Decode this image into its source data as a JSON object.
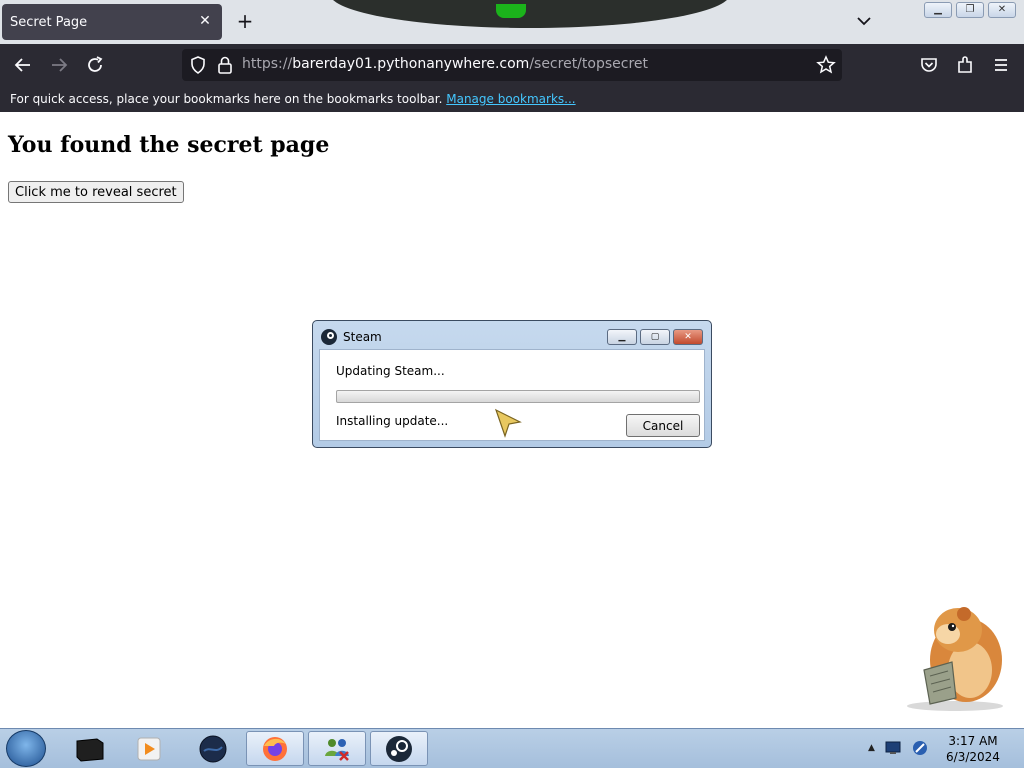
{
  "browser": {
    "tab": {
      "title": "Secret Page"
    },
    "address": {
      "prefix": "https://",
      "domain": "barerday01.pythonanywhere.com",
      "path": "/secret/topsecret"
    },
    "bookmarks_bar": {
      "message": "For quick access, place your bookmarks here on the bookmarks toolbar.",
      "link_label": "Manage bookmarks..."
    }
  },
  "page": {
    "heading": "You found the secret page",
    "button_label": "Click me to reveal secret"
  },
  "steam_dialog": {
    "title": "Steam",
    "status": "Updating Steam...",
    "progress_percent": 0,
    "detail": "Installing update...",
    "cancel_label": "Cancel"
  },
  "taskbar": {
    "items": [
      {
        "name": "start-orb-icon"
      },
      {
        "name": "dark-device-icon"
      },
      {
        "name": "media-player-icon"
      },
      {
        "name": "dark-globe-icon"
      },
      {
        "name": "firefox-icon"
      },
      {
        "name": "network-people-icon"
      },
      {
        "name": "steam-icon"
      }
    ],
    "clock": {
      "time": "3:17 AM",
      "date": "6/3/2024"
    }
  },
  "colors": {
    "browser_chrome": "#2b2a33",
    "link": "#44c7ff",
    "taskbar": "#b9cfe6"
  }
}
